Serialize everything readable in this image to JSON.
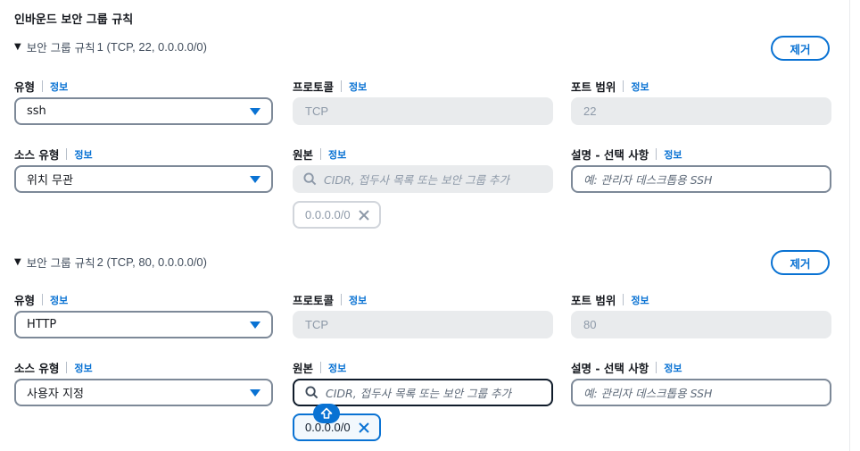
{
  "section": {
    "title": "인바운드 보안 그룹 규칙"
  },
  "common": {
    "info": "정보",
    "remove": "제거"
  },
  "rules": [
    {
      "header_prefix": "보안 그룹 규칙",
      "header_meta": "1 (TCP, 22, 0.0.0.0/0)",
      "type": {
        "label": "유형",
        "value": "ssh"
      },
      "protocol": {
        "label": "프로토콜",
        "value": "TCP"
      },
      "port": {
        "label": "포트 범위",
        "value": "22"
      },
      "source_type": {
        "label": "소스 유형",
        "value": "위치 무관"
      },
      "source": {
        "label": "원본",
        "placeholder": "CIDR, 접두사 목록 또는 보안 그룹 추가",
        "token": "0.0.0.0/0"
      },
      "description": {
        "label": "설명 - 선택 사항",
        "placeholder": "예: 관리자 데스크톱용 SSH"
      }
    },
    {
      "header_prefix": "보안 그룹 규칙",
      "header_meta": "2 (TCP, 80, 0.0.0.0/0)",
      "type": {
        "label": "유형",
        "value": "HTTP"
      },
      "protocol": {
        "label": "프로토콜",
        "value": "TCP"
      },
      "port": {
        "label": "포트 범위",
        "value": "80"
      },
      "source_type": {
        "label": "소스 유형",
        "value": "사용자 지정"
      },
      "source": {
        "label": "원본",
        "placeholder": "CIDR, 접두사 목록 또는 보안 그룹 추가",
        "token": "0.0.0.0/0"
      },
      "description": {
        "label": "설명 - 선택 사항",
        "placeholder": "예: 관리자 데스크톱용 SSH"
      }
    }
  ],
  "colors": {
    "accent": "#0972d3",
    "text": "#16191f",
    "muted": "#8d99a8",
    "readonly_bg": "#e9ebed"
  },
  "icons": {
    "remove_token": "close-icon",
    "search": "search-icon",
    "caret": "caret-down-icon",
    "badge": "shift-arrow-icon"
  }
}
